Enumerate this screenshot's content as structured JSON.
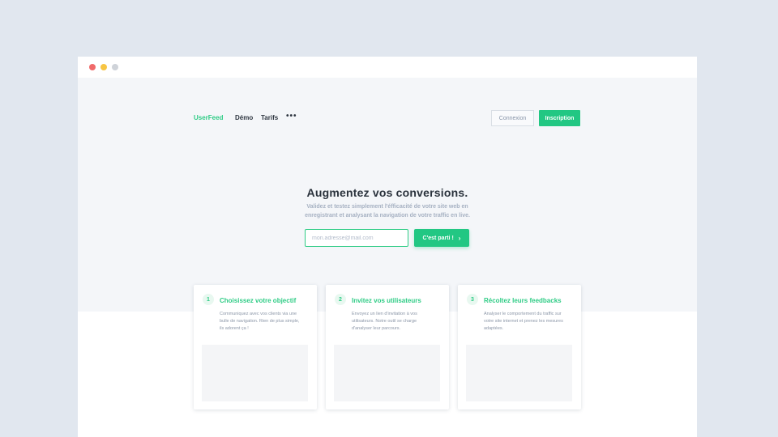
{
  "window_controls": [
    "close",
    "minimize",
    "maximize"
  ],
  "nav": {
    "brand": "UserFeed",
    "links": [
      "Démo",
      "Tarifs"
    ],
    "more": "•••",
    "login_label": "Connexion",
    "signup_label": "Inscription"
  },
  "hero": {
    "headline": "Augmentez vos conversions.",
    "subline": "Validez et testez simplement l'éfficacité de votre site web en enregistrant et analysant la navigation de votre traffic en live.",
    "email_placeholder": "mon.adresse@mail.com",
    "cta_label": "C'est parti !",
    "cta_icon": "chevron-right-icon"
  },
  "steps": [
    {
      "number": "1",
      "title": "Choisissez votre objectif",
      "text": "Communiquez avec vos clients via une bulle de navigation. Rien de plus simple, ils adorent ça !"
    },
    {
      "number": "2",
      "title": "Invitez vos utilisateurs",
      "text": "Envoyez un lien d'invitation à vos utilisateurs. Notre outil se charge d'analyser leur parcours."
    },
    {
      "number": "3",
      "title": "Récoltez leurs feedbacks",
      "text": "Analyser le comportement du traffic sur votre site internet et prenez les mesures adaptées."
    }
  ],
  "colors": {
    "accent": "#22c783",
    "background": "#e1e7ef",
    "hero_bg": "#f4f6f9"
  }
}
